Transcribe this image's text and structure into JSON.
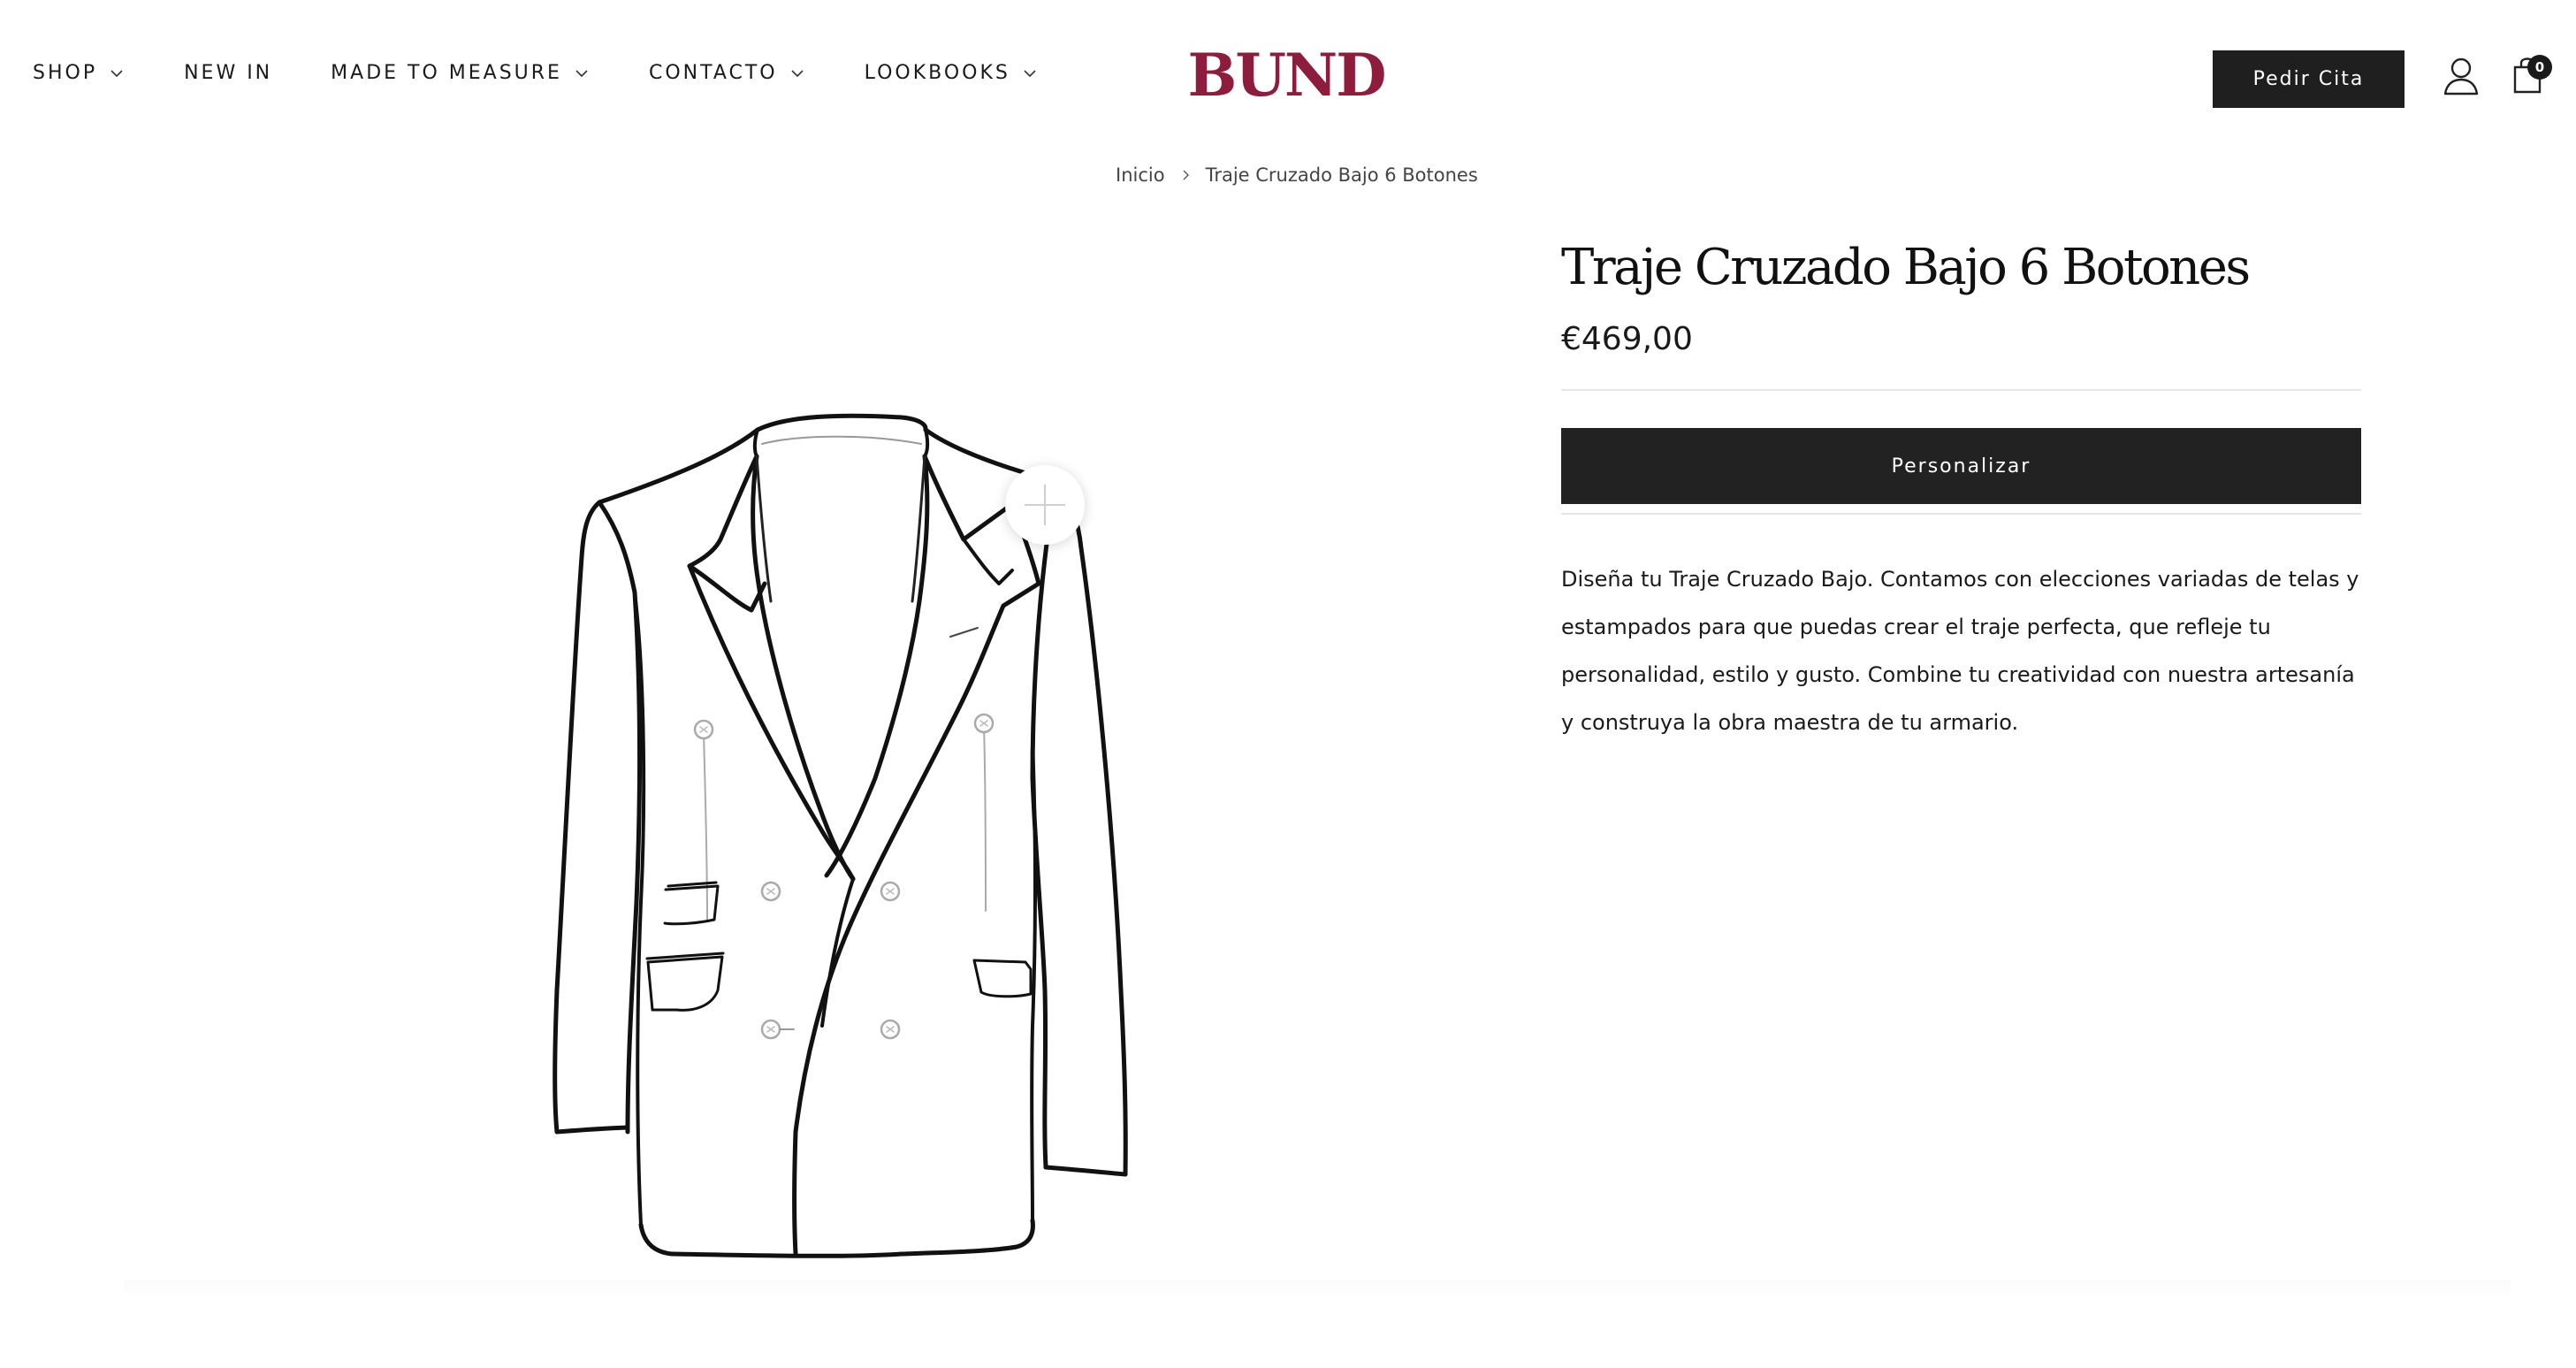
{
  "nav": {
    "items": [
      {
        "label": "SHOP",
        "has_dropdown": true
      },
      {
        "label": "NEW IN",
        "has_dropdown": false
      },
      {
        "label": "MADE TO MEASURE",
        "has_dropdown": true
      },
      {
        "label": "CONTACTO",
        "has_dropdown": true
      },
      {
        "label": "LOOKBOOKS",
        "has_dropdown": true
      }
    ]
  },
  "brand": {
    "logo_text": "BUND",
    "color": "#8e1c3d"
  },
  "header": {
    "appointment_label": "Pedir Cita",
    "cart_count": "0",
    "icons": [
      "user-icon",
      "shopping-bag-icon"
    ]
  },
  "breadcrumb": {
    "home": "Inicio",
    "current": "Traje Cruzado Bajo 6 Botones"
  },
  "product": {
    "title": "Traje Cruzado Bajo 6 Botones",
    "price": "€469,00",
    "cta_label": "Personalizar",
    "description": "Diseña tu Traje Cruzado Bajo. Contamos con elecciones variadas de telas y estampados para que puedas crear el traje perfecta, que refleje tu personalidad, estilo y gusto. Combine tu creatividad con nuestra artesanía y construya la obra maestra de tu armario.",
    "image": "double-breasted-jacket-line-drawing",
    "zoom_icon": "plus-icon"
  },
  "colors": {
    "dark": "#1f1f1f",
    "brand": "#8e1c3d",
    "divider": "#e6e6e6"
  }
}
